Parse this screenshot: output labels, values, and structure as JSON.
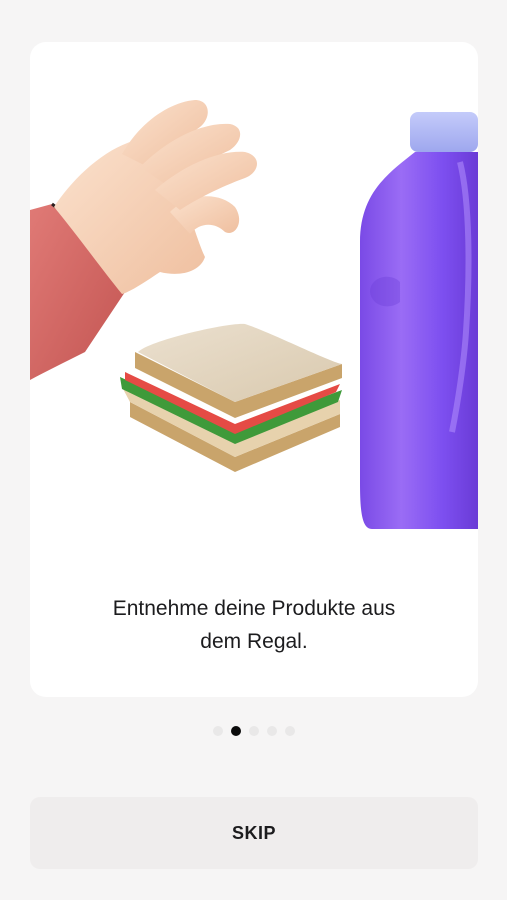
{
  "onboarding": {
    "caption": "Entnehme deine Produkte aus\ndem Regal.",
    "illustration_icons": [
      "hand-icon",
      "sandwich-icon",
      "bottle-icon"
    ],
    "page_indicator": {
      "total": 5,
      "current": 2
    },
    "skip_label": "SKIP"
  },
  "colors": {
    "background": "#f6f5f5",
    "card": "#ffffff",
    "bottle": "#7b4bea",
    "bottle_cap": "#aeb7f5",
    "sleeve": "#d96c6a",
    "hand": "#f8d4bc",
    "dot_active": "#0b0b0b",
    "dot_inactive": "#e9e8e8",
    "skip_button": "#efeded"
  }
}
